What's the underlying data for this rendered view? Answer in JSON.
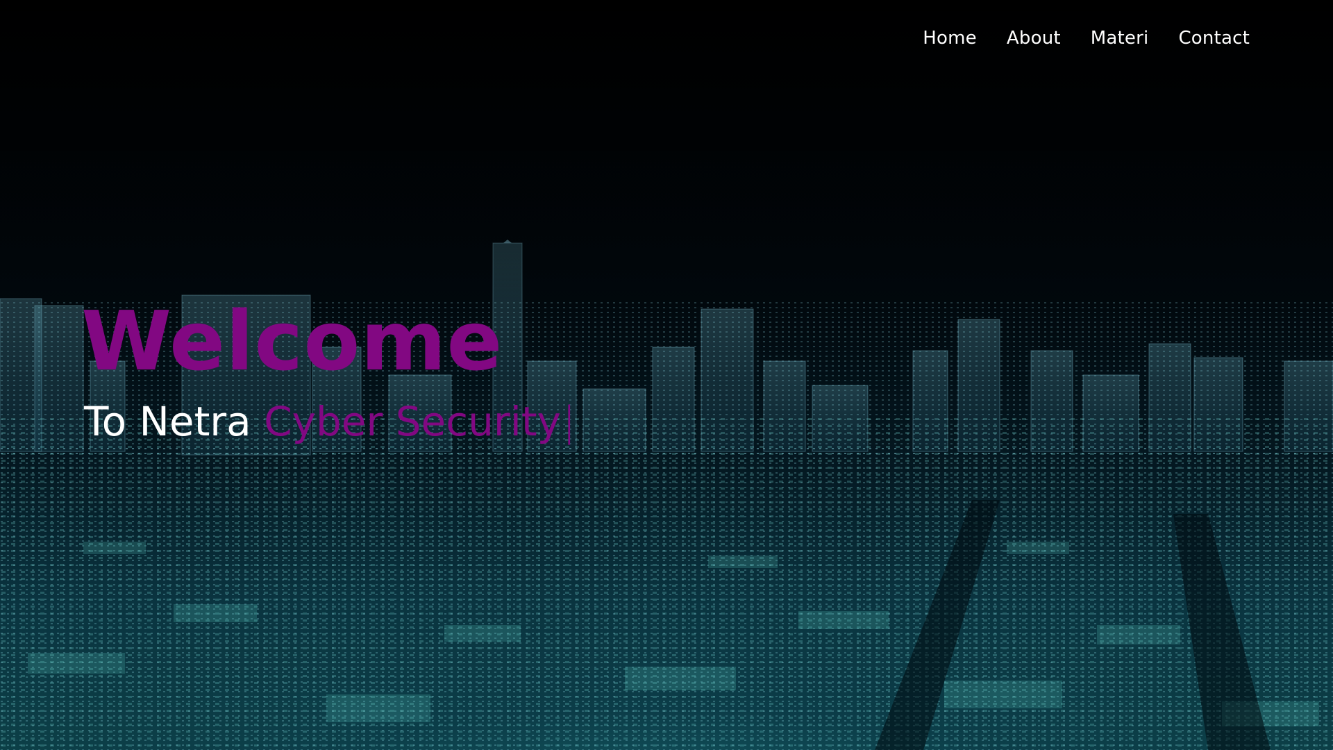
{
  "nav": {
    "items": [
      {
        "label": "Home"
      },
      {
        "label": "About"
      },
      {
        "label": "Materi"
      },
      {
        "label": "Contact"
      }
    ]
  },
  "hero": {
    "title": "Welcome",
    "subtitle_prefix": "To Netra",
    "subtitle_highlight": "Cyber Security",
    "cursor": "|",
    "background_icon": "digital-city-background"
  },
  "colors": {
    "accent": "#820882",
    "text": "#ffffff",
    "background": "#02060a",
    "glow": "#2fa3b0"
  }
}
